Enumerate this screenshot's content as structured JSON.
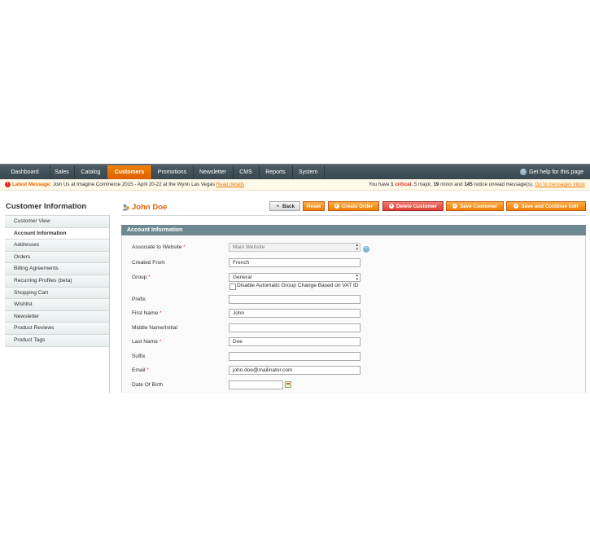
{
  "nav": {
    "items": [
      {
        "label": "Dashboard"
      },
      {
        "label": "Sales"
      },
      {
        "label": "Catalog"
      },
      {
        "label": "Customers",
        "active": true
      },
      {
        "label": "Promotions"
      },
      {
        "label": "Newsletter"
      },
      {
        "label": "CMS"
      },
      {
        "label": "Reports"
      },
      {
        "label": "System"
      }
    ],
    "help_label": "Get help for this page",
    "active_color": "#eb5e00"
  },
  "message_bar": {
    "label": "Latest Message:",
    "text": "Join Us at Imagine Commerce 2015 - April 20-22 at the Wynn Las Vegas",
    "read_details": "Read details",
    "summary_prefix": "You have",
    "critical_count": "1",
    "critical_word": "critical",
    "major": ", 5 major,",
    "minor_count": "19",
    "minor_text": "minor and",
    "notice_count": "145",
    "notice_text": "notice unread message(s).",
    "inbox_link": "Go to messages inbox"
  },
  "sidebar": {
    "title": "Customer Information",
    "items": [
      {
        "label": "Customer View"
      },
      {
        "label": "Account Information",
        "active": true
      },
      {
        "label": "Addresses"
      },
      {
        "label": "Orders"
      },
      {
        "label": "Billing Agreements"
      },
      {
        "label": "Recurring Profiles (beta)"
      },
      {
        "label": "Shopping Cart"
      },
      {
        "label": "Wishlist"
      },
      {
        "label": "Newsletter"
      },
      {
        "label": "Product Reviews"
      },
      {
        "label": "Product Tags"
      }
    ]
  },
  "header": {
    "title": "John Doe",
    "buttons": {
      "back": "Back",
      "reset": "Reset",
      "create_order": "Create Order",
      "delete": "Delete Customer",
      "save": "Save Customer",
      "save_continue": "Save and Continue Edit"
    }
  },
  "account": {
    "section_title": "Account Information",
    "required_mark": "*",
    "fields": {
      "website": {
        "label": "Associate to Website",
        "value": "Main Website"
      },
      "created_from": {
        "label": "Created From",
        "value": "French"
      },
      "group": {
        "label": "Group",
        "value": "General"
      },
      "disable_group_change": {
        "label": "Disable Automatic Group Change Based on VAT ID"
      },
      "prefix": {
        "label": "Prefix",
        "value": ""
      },
      "first_name": {
        "label": "First Name",
        "value": "John"
      },
      "middle_name": {
        "label": "Middle Name/Initial",
        "value": ""
      },
      "last_name": {
        "label": "Last Name",
        "value": "Doe"
      },
      "suffix": {
        "label": "Suffix",
        "value": ""
      },
      "email": {
        "label": "Email",
        "value": "john.doe@mailinator.com"
      },
      "dob": {
        "label": "Date Of Birth",
        "value": ""
      }
    }
  }
}
